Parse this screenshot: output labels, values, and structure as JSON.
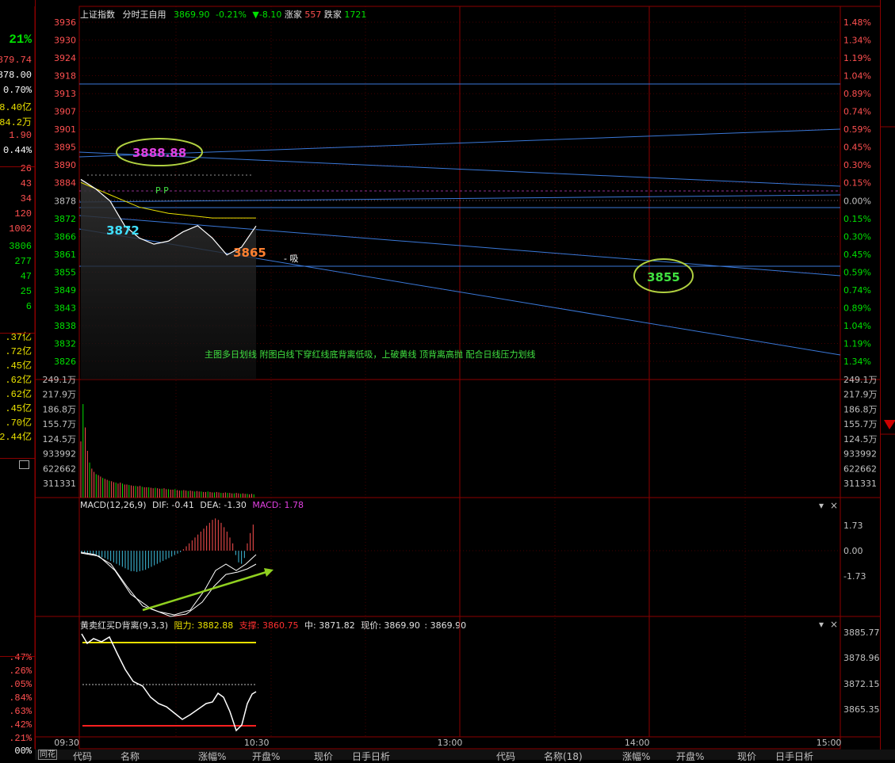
{
  "left_panel": {
    "items": [
      {
        "text": "21%",
        "color": "#00e000"
      },
      {
        "text": "879.74",
        "color": "#ff5050"
      },
      {
        "text": "3878.00",
        "color": "#ffffff"
      },
      {
        "text": "0.70%",
        "color": "#ffffff"
      },
      {
        "text": "8.40亿",
        "color": "#e8e000"
      },
      {
        "text": "84.2万",
        "color": "#e8e000"
      },
      {
        "text": "1.90",
        "color": "#ff5050"
      },
      {
        "text": "0.44%",
        "color": "#ffffff"
      },
      {
        "text": "26",
        "color": "#ff5050"
      },
      {
        "text": "43",
        "color": "#ff5050"
      },
      {
        "text": "34",
        "color": "#ff5050"
      },
      {
        "text": "120",
        "color": "#ff5050"
      },
      {
        "text": "1002",
        "color": "#ff5050"
      },
      {
        "text": "3806",
        "color": "#00e000"
      },
      {
        "text": "277",
        "color": "#00e000"
      },
      {
        "text": "47",
        "color": "#00e000"
      },
      {
        "text": "25",
        "color": "#00e000"
      },
      {
        "text": "6",
        "color": "#00e000"
      },
      {
        "text": ".37亿",
        "color": "#e8e000"
      },
      {
        "text": ".72亿",
        "color": "#e8e000"
      },
      {
        "text": ".45亿",
        "color": "#e8e000"
      },
      {
        "text": ".62亿",
        "color": "#e8e000"
      },
      {
        "text": ".62亿",
        "color": "#e8e000"
      },
      {
        "text": ".45亿",
        "color": "#e8e000"
      },
      {
        "text": ".70亿",
        "color": "#e8e000"
      },
      {
        "text": "2.44亿",
        "color": "#e8e000"
      },
      {
        "text": ".47%",
        "color": "#ff5050"
      },
      {
        "text": ".26%",
        "color": "#ff5050"
      },
      {
        "text": ".05%",
        "color": "#ff5050"
      },
      {
        "text": ".84%",
        "color": "#ff5050"
      },
      {
        "text": ".63%",
        "color": "#ff5050"
      },
      {
        "text": ".42%",
        "color": "#ff5050"
      },
      {
        "text": ".21%",
        "color": "#ff5050"
      },
      {
        "text": "00%",
        "color": "#ffffff"
      }
    ]
  },
  "header": {
    "index_name": "上证指数",
    "chart_mode": "分时王自用",
    "price": "3869.90",
    "change_pct": "-0.21%",
    "change_arrow": "▼",
    "change_val": "-8.10",
    "up_label": "涨家",
    "up_count": "557",
    "down_label": "跌家",
    "down_count": "1721"
  },
  "annotations": {
    "ellipse_1": "3888.88",
    "ellipse_2": "3855",
    "label_low": "3872",
    "label_cur": "3865",
    "pp": "P P",
    "xi": "- 吸",
    "note": "主图多日划线 附图白线下穿红线底背离低吸，上破黄线 顶背离高抛 配合日线压力划线"
  },
  "macd": {
    "title": "MACD(12,26,9)",
    "dif": "DIF: -0.41",
    "dea": "DEA: -1.30",
    "macd": "MACD: 1.78"
  },
  "div": {
    "title": "黄卖红买D背离(9,3,3)",
    "zl_label": "阻力:",
    "zl": "3882.88",
    "zc_label": "支撑:",
    "zc": "3860.75",
    "zhong_label": "中:",
    "zhong": "3871.82",
    "xj_label": "现价:",
    "xj": "3869.90",
    "extra": ": 3869.90"
  },
  "bottom_bar": {
    "items": [
      "同花",
      "代码",
      "名称",
      "涨幅%",
      "开盘%",
      "现价",
      "日手日析",
      "代码",
      "名称(18)",
      "涨幅%",
      "开盘%",
      "现价",
      "日手日析"
    ]
  },
  "chart_data": [
    {
      "type": "line",
      "name": "price",
      "x": [
        "09:30",
        "09:35",
        "09:40",
        "09:45",
        "09:50",
        "09:55",
        "10:00",
        "10:05",
        "10:10",
        "10:15",
        "10:20",
        "10:25",
        "10:30"
      ],
      "y": [
        3885.0,
        3882.0,
        3878.0,
        3870.0,
        3866.0,
        3864.0,
        3865.0,
        3868.0,
        3870.0,
        3866.0,
        3860.5,
        3863.0,
        3869.9
      ],
      "price_ticks": [
        "3936",
        "3930",
        "3924",
        "3918",
        "3913",
        "3907",
        "3901",
        "3895",
        "3890",
        "3884",
        "3878",
        "3872",
        "3866",
        "3861",
        "3855",
        "3849",
        "3843",
        "3838",
        "3832",
        "3826"
      ],
      "pct_ticks": [
        "1.48%",
        "1.34%",
        "1.19%",
        "1.04%",
        "0.89%",
        "0.74%",
        "0.59%",
        "0.45%",
        "0.30%",
        "0.15%",
        "0.00%",
        "0.15%",
        "0.30%",
        "0.45%",
        "0.59%",
        "0.74%",
        "0.89%",
        "1.04%",
        "1.19%",
        "1.34%"
      ],
      "avg_line": [
        3884,
        3882,
        3880,
        3878,
        3876,
        3875,
        3874,
        3873.5,
        3873,
        3872.5,
        3872.5,
        3872.5,
        3872.5
      ],
      "ylim": [
        3826,
        3936
      ],
      "x_ticks": [
        "09:30",
        "10:30",
        "13:00",
        "14:00",
        "15:00"
      ]
    },
    {
      "type": "bar",
      "name": "volume",
      "y_ticks": [
        "249.1万",
        "217.9万",
        "186.8万",
        "155.7万",
        "124.5万",
        "933992",
        "622662",
        "311331"
      ],
      "values_wan": [
        120,
        200,
        150,
        100,
        75,
        62,
        55,
        50,
        48,
        45,
        42,
        40,
        38,
        36,
        35,
        33,
        32,
        30,
        32,
        30,
        28,
        28,
        27,
        26,
        25,
        25,
        24,
        25,
        23,
        22,
        22,
        22,
        21,
        20,
        21,
        20,
        19,
        19,
        20,
        18,
        18,
        17,
        17,
        18,
        16,
        15,
        15,
        16,
        15,
        14,
        15,
        14,
        13,
        14,
        13,
        13,
        12,
        12,
        13,
        12,
        11,
        11,
        12,
        11,
        10,
        10,
        11,
        10,
        10,
        9,
        9,
        10,
        9,
        8,
        9,
        8,
        8,
        7,
        8,
        7
      ]
    },
    {
      "type": "bar",
      "name": "macd",
      "y_ticks": [
        "1.73",
        "0.00",
        "-1.73"
      ],
      "values": [
        -0.1,
        -0.15,
        -0.2,
        -0.25,
        -0.3,
        -0.35,
        -0.4,
        -0.45,
        -0.5,
        -0.6,
        -0.7,
        -0.8,
        -0.9,
        -1.0,
        -1.1,
        -1.2,
        -1.3,
        -1.4,
        -1.4,
        -1.45,
        -1.4,
        -1.35,
        -1.3,
        -1.2,
        -1.1,
        -1.0,
        -0.9,
        -0.8,
        -0.7,
        -0.6,
        -0.5,
        -0.4,
        -0.3,
        -0.2,
        -0.1,
        0.1,
        0.3,
        0.5,
        0.7,
        0.9,
        1.1,
        1.3,
        1.5,
        1.7,
        1.9,
        2.1,
        2.2,
        2.1,
        1.9,
        1.6,
        1.3,
        0.9,
        0.5,
        -0.3,
        -0.8,
        -0.9,
        -0.5,
        0.5,
        1.2,
        1.78
      ]
    },
    {
      "type": "line",
      "name": "divergence",
      "y_ticks": [
        "3885.77",
        "3878.96",
        "3872.15",
        "3865.35"
      ],
      "resistance": 3882.88,
      "support": 3860.75,
      "middle": 3871.82
    }
  ],
  "colors": {
    "border": "#8b0000",
    "up": "#ff5050",
    "down": "#00e000",
    "price_line": "#ffffff",
    "avg_line": "#e8e000",
    "trend_line": "#3a78d8"
  }
}
